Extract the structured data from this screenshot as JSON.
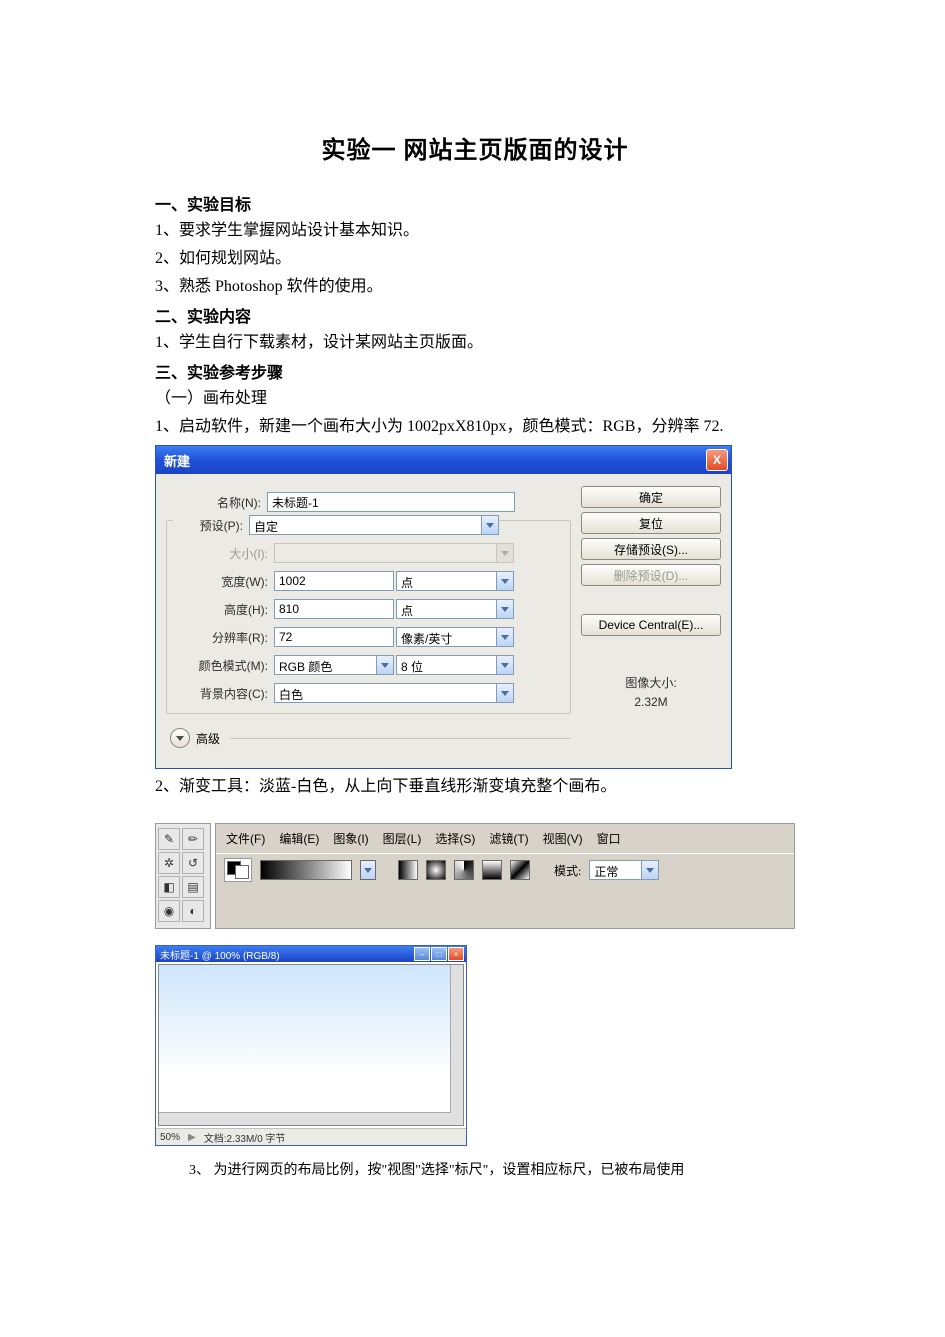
{
  "title": "实验一   网站主页版面的设计",
  "s1_head": "一、实验目标",
  "s1_items": [
    "1、要求学生掌握网站设计基本知识。",
    "2、如何规划网站。",
    "3、熟悉 Photoshop 软件的使用。"
  ],
  "s2_head": "二、实验内容",
  "s2_items": [
    "1、学生自行下载素材，设计某网站主页版面。"
  ],
  "s3_head": "三、实验参考步骤",
  "s3_sub": "（一）画布处理",
  "s3_step1": "1、启动软件，新建一个画布大小为 1002pxX810px，颜色模式：RGB，分辨率 72.",
  "s3_step2": "2、渐变工具：淡蓝-白色，从上向下垂直线形渐变填充整个画布。",
  "s3_step3": "3、 为进行网页的布局比例，按\"视图\"选择\"标尺\"，设置相应标尺，已被布局使用",
  "dlg": {
    "title": "新建",
    "close": "X",
    "labels": {
      "name": "名称(N):",
      "preset": "预设(P):",
      "size": "大小(I):",
      "width": "宽度(W):",
      "height": "高度(H):",
      "res": "分辨率(R):",
      "mode": "颜色模式(M):",
      "bg": "背景内容(C):",
      "adv": "高级"
    },
    "values": {
      "name": "未标题-1",
      "preset": "自定",
      "size": "",
      "width": "1002",
      "height": "810",
      "res": "72",
      "mode": "RGB 颜色",
      "bits": "8 位",
      "bg": "白色",
      "wunit": "点",
      "hunit": "点",
      "runit": "像素/英寸"
    },
    "buttons": {
      "ok": "确定",
      "reset": "复位",
      "save": "存储预设(S)...",
      "delete": "删除预设(D)...",
      "device": "Device Central(E)..."
    },
    "imgsize_label": "图像大小:",
    "imgsize_value": "2.32M"
  },
  "menubar": {
    "file": "文件(F)",
    "edit": "编辑(E)",
    "image": "图象(I)",
    "layer": "图层(L)",
    "select": "选择(S)",
    "filter": "滤镜(T)",
    "view": "视图(V)",
    "window": "窗口"
  },
  "optbar": {
    "mode_label": "模式:",
    "mode_value": "正常"
  },
  "canvas": {
    "title": "未标题-1 @ 100% (RGB/8)",
    "zoom": "50%",
    "status": "文档:2.33M/0 字节"
  }
}
